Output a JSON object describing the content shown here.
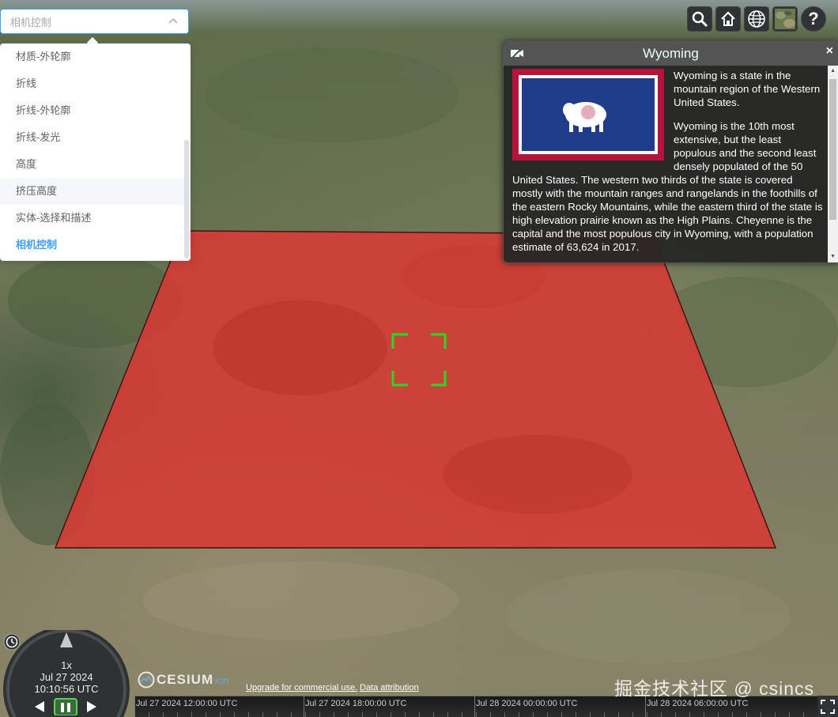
{
  "dropdown": {
    "selected": "相机控制",
    "items": [
      {
        "label": "材质-外轮廓",
        "state": "normal"
      },
      {
        "label": "折线",
        "state": "normal"
      },
      {
        "label": "折线-外轮廓",
        "state": "normal"
      },
      {
        "label": "折线-发光",
        "state": "normal"
      },
      {
        "label": "高度",
        "state": "normal"
      },
      {
        "label": "挤压高度",
        "state": "hover"
      },
      {
        "label": "实体-选择和描述",
        "state": "normal"
      },
      {
        "label": "相机控制",
        "state": "selected"
      }
    ]
  },
  "toolbar": {
    "icons": [
      "search-icon",
      "home-icon",
      "globe-icon",
      "base-layer-picker-icon",
      "help-icon"
    ],
    "help_label": "?"
  },
  "infobox": {
    "title": "Wyoming",
    "close_label": "×",
    "paragraphs": [
      "Wyoming is a state in the mountain region of the Western United States.",
      "Wyoming is the 10th most extensive, but the least populous and the second least densely populated of the 50 United States. The western two thirds of the state is covered mostly with the mountain ranges and rangelands in the foothills of the eastern Rocky Mountains, while the eastern third of the state is high elevation prairie known as the High Plains. Cheyenne is the capital and the most populous city in Wyoming, with a population estimate of 63,624 in 2017."
    ],
    "flag_colors": {
      "border": "#b5143a",
      "field": "#1e3c8a",
      "inner": "#ffffff"
    }
  },
  "polygon": {
    "fill": "#d63a33"
  },
  "animation": {
    "speed": "1x",
    "date": "Jul 27 2024",
    "time": "10:10:56 UTC"
  },
  "timeline": {
    "ticks": [
      "Jul 27 2024 12:00:00 UTC",
      "Jul 27 2024 18:00:00 UTC",
      "Jul 28 2024 00:00:00 UTC",
      "Jul 28 2024 06:00:00 UTC"
    ]
  },
  "credits": {
    "logo_text": "CESIUM",
    "logo_suffix": "ion",
    "upgrade_link": "Upgrade for commercial use.",
    "attribution_link": "Data attribution"
  },
  "watermark": "掘金技术社区 @ csincs"
}
